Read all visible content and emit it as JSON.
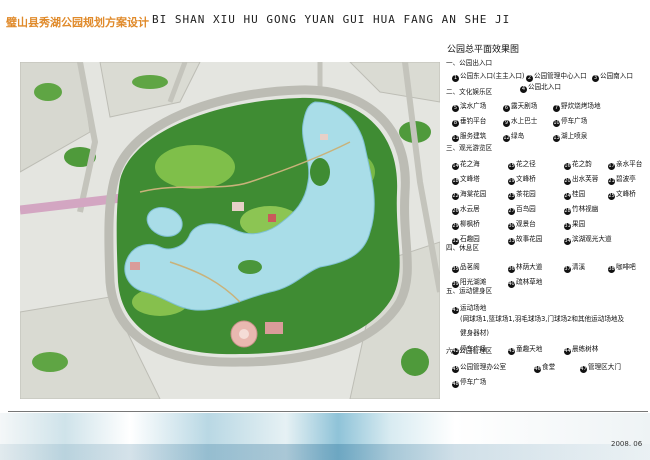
{
  "header": {
    "title_cn": "璧山县秀湖公园规划方案设计",
    "title_en": "BI SHAN XIU HU GONG YUAN GUI HUA FANG AN SHE JI"
  },
  "plan": {
    "subtitle": "公园总平面效果图",
    "colors": {
      "water": "#a9dde8",
      "forest": "#2f7d2f",
      "grass": "#7fbf4a",
      "road": "#b9b9b2",
      "field": "#dcdcd4",
      "plaza": "#e9b8b0",
      "path": "#c9b27a"
    }
  },
  "legend": {
    "s1": "一、公园出入口",
    "s1_items": [
      {
        "n": "1",
        "t": "公园东入口(主主入口)"
      },
      {
        "n": "2",
        "t": "公园管理中心入口"
      },
      {
        "n": "3",
        "t": "公园南入口"
      },
      {
        "n": "4",
        "t": "公园北入口"
      }
    ],
    "s2": "二、文化娱乐区",
    "s2_items": [
      {
        "n": "5",
        "t": "滨水广场"
      },
      {
        "n": "6",
        "t": "露天剧场"
      },
      {
        "n": "7",
        "t": "野炊烧烤场地"
      },
      {
        "n": "8",
        "t": "垂钓平台"
      },
      {
        "n": "9",
        "t": "水上巴士"
      },
      {
        "n": "10",
        "t": "停车广场"
      },
      {
        "n": "11",
        "t": "服务建筑"
      },
      {
        "n": "12",
        "t": "绿岛"
      },
      {
        "n": "13",
        "t": "湖上喷泉"
      }
    ],
    "s3": "三、观光游览区",
    "s3_items": [
      {
        "n": "14",
        "t": "花之海"
      },
      {
        "n": "15",
        "t": "花之径"
      },
      {
        "n": "16",
        "t": "花之韵"
      },
      {
        "n": "17",
        "t": "亲水平台"
      },
      {
        "n": "18",
        "t": "文峰塔"
      },
      {
        "n": "19",
        "t": "文峰桥"
      },
      {
        "n": "20",
        "t": "出水芙蓉"
      },
      {
        "n": "21",
        "t": "碧波亭"
      },
      {
        "n": "22",
        "t": "海棠花园"
      },
      {
        "n": "23",
        "t": "茶花园"
      },
      {
        "n": "24",
        "t": "桂园"
      },
      {
        "n": "25",
        "t": "文峰桥"
      },
      {
        "n": "26",
        "t": "水云居"
      },
      {
        "n": "27",
        "t": "百鸟园"
      },
      {
        "n": "28",
        "t": "竹林视幽"
      },
      {
        "n": "29",
        "t": "柳枫桥"
      },
      {
        "n": "30",
        "t": "观景台"
      },
      {
        "n": "31",
        "t": "果园"
      },
      {
        "n": "32",
        "t": "石趣园"
      },
      {
        "n": "33",
        "t": "故事花园"
      },
      {
        "n": "34",
        "t": "滨湖观光大道"
      }
    ],
    "s4": "四、休息区",
    "s4_items": [
      {
        "n": "35",
        "t": "品茗阁"
      },
      {
        "n": "36",
        "t": "林荫大道"
      },
      {
        "n": "37",
        "t": "清溪"
      },
      {
        "n": "38",
        "t": "咖啡吧"
      },
      {
        "n": "39",
        "t": "阳光湖滩"
      },
      {
        "n": "40",
        "t": "疏林草地"
      }
    ],
    "s5": "五、运动健身区",
    "s5_items": [
      {
        "n": "41",
        "t": "运动场地"
      }
    ],
    "s5_note1": "(网球场1,篮球场1,羽毛球场3,门球场2和其他运动场地及",
    "s5_note2": "健身器材)",
    "s5_items2": [
      {
        "n": "42",
        "t": "停车广场"
      },
      {
        "n": "43",
        "t": "童趣天地"
      },
      {
        "n": "44",
        "t": "晨练树林"
      }
    ],
    "s6": "六、公园管理区",
    "s6_items": [
      {
        "n": "45",
        "t": "公园管理办公室"
      },
      {
        "n": "46",
        "t": "食堂"
      },
      {
        "n": "47",
        "t": "管理区大门"
      },
      {
        "n": "48",
        "t": "停车广场"
      }
    ]
  },
  "footer": {
    "date": "2008. 06"
  }
}
